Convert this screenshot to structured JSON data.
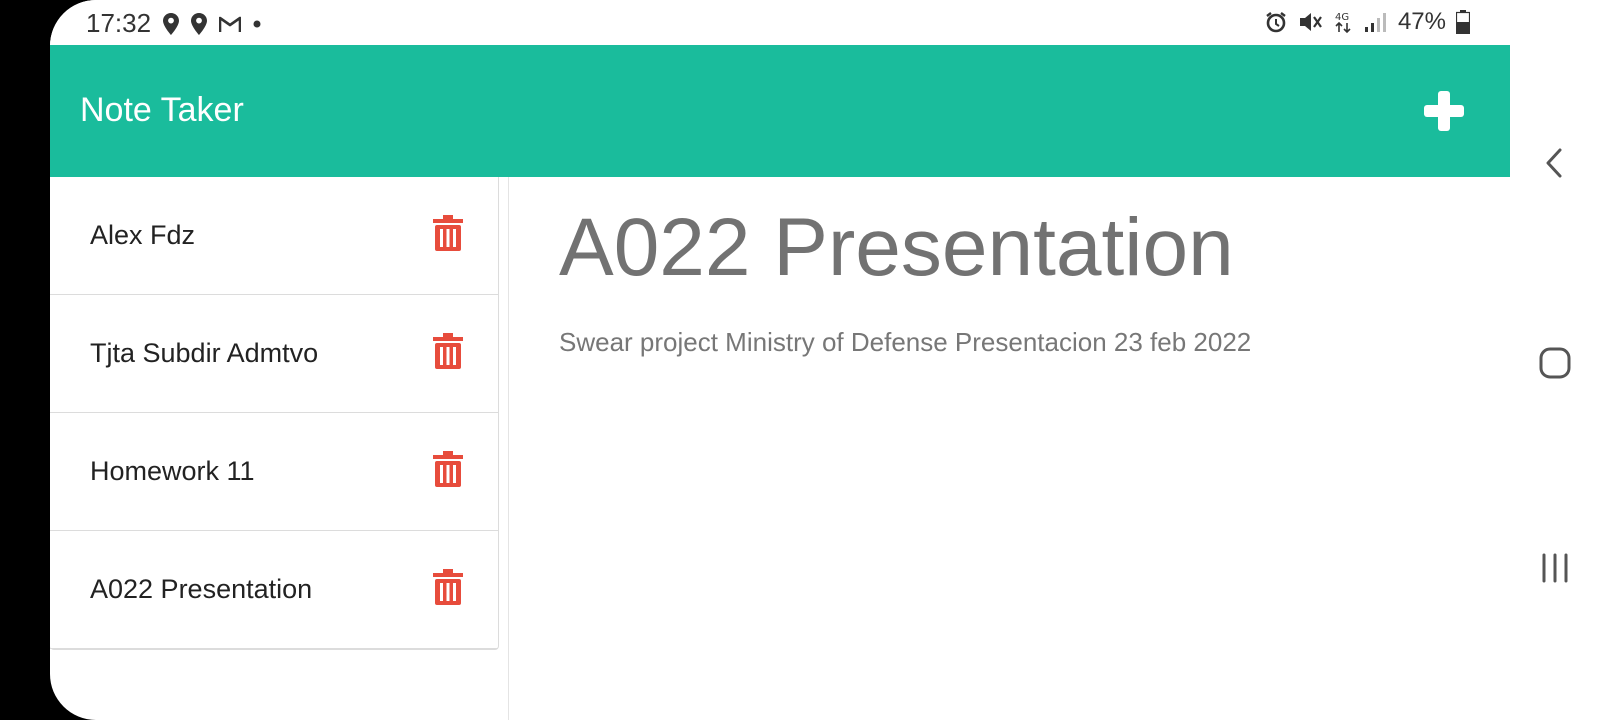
{
  "status_bar": {
    "time": "17:32",
    "battery_text": "47%",
    "network_label": "4G",
    "left_icons": [
      "location-icon",
      "location-icon",
      "gmail-icon",
      "dot-icon"
    ],
    "right_icons": [
      "alarm-icon",
      "mute-icon",
      "network-4g-icon",
      "signal-icon",
      "battery-icon"
    ]
  },
  "app": {
    "title": "Note Taker",
    "add_icon": "plus-icon",
    "accent_color": "#1abc9c",
    "delete_color": "#e74c3c"
  },
  "notes": [
    {
      "title": "Alex Fdz"
    },
    {
      "title": "Tjta Subdir Admtvo"
    },
    {
      "title": "Homework 11"
    },
    {
      "title": "A022 Presentation"
    }
  ],
  "active_note": {
    "title": "A022 Presentation",
    "text": "Swear project Ministry of Defense Presentacion 23 feb 2022"
  },
  "nav": {
    "back_icon": "back-chevron-icon",
    "home_icon": "home-icon",
    "recents_icon": "recents-icon"
  }
}
